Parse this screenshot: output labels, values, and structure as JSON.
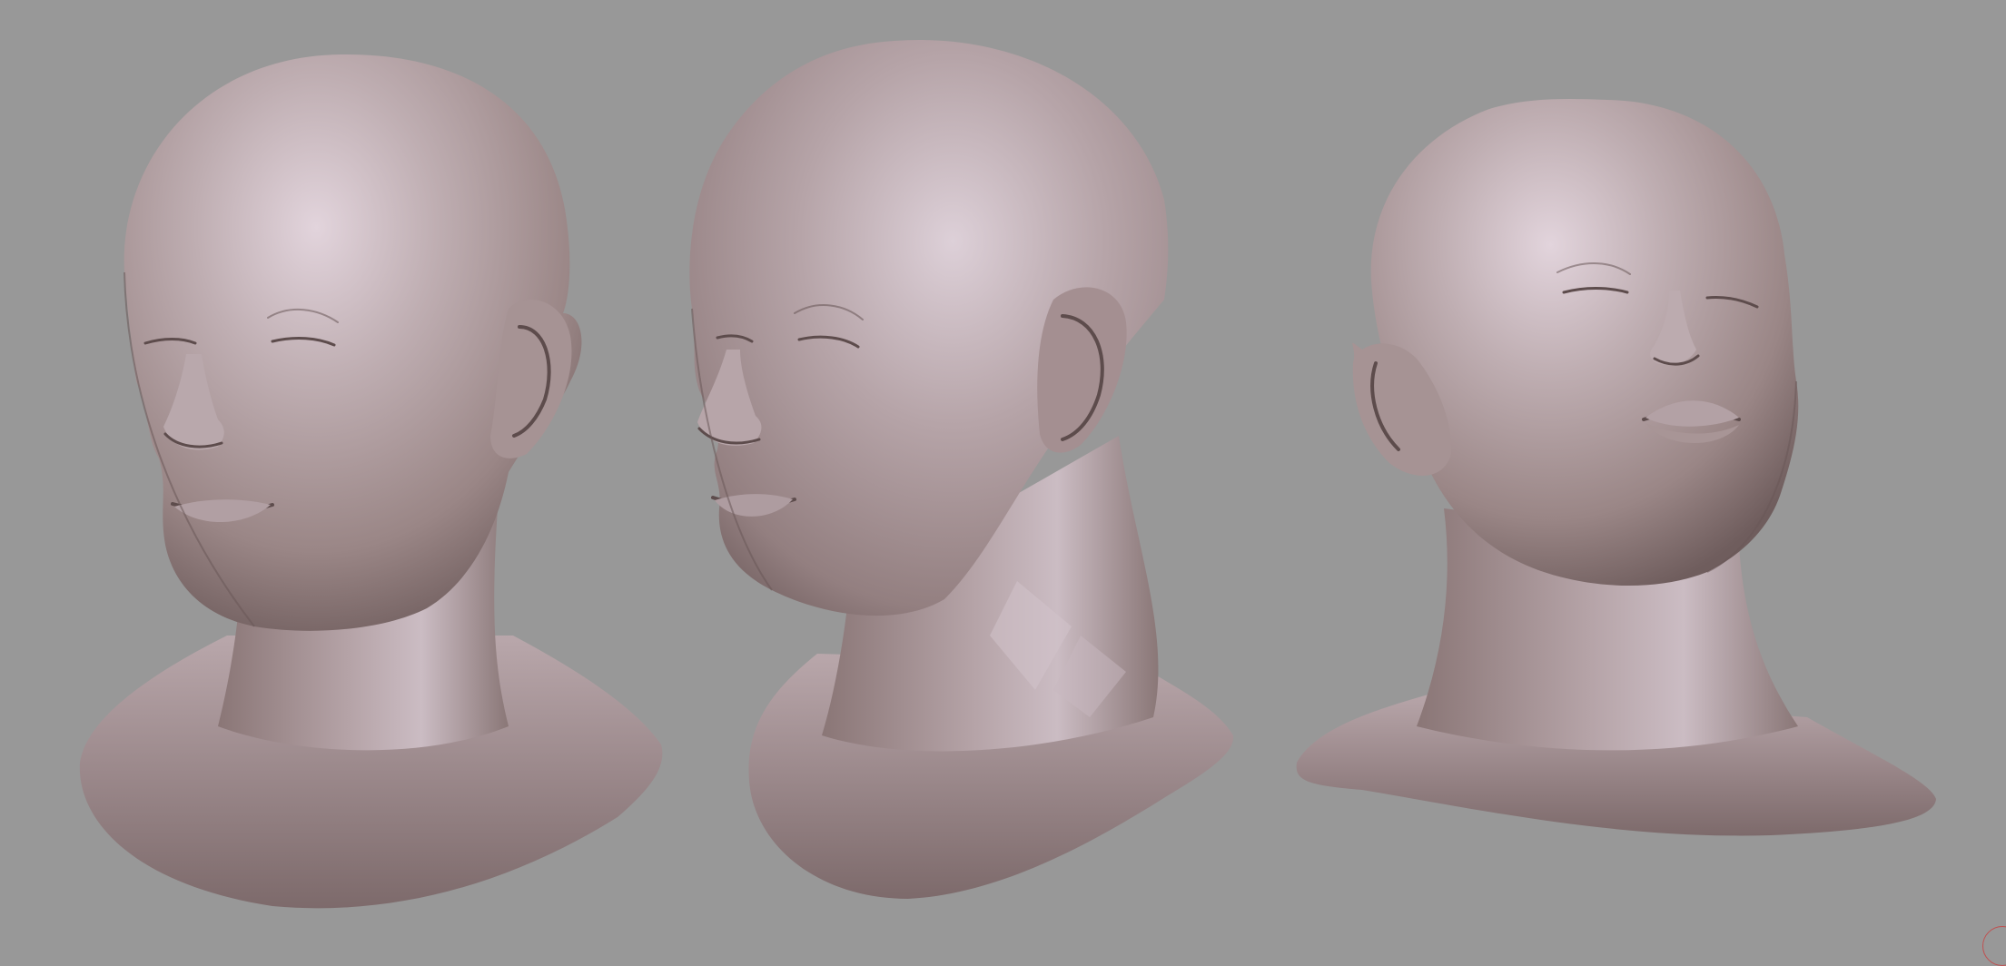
{
  "scene": {
    "background_color": "#989898",
    "material_base_color": "#a89696",
    "material_highlight_color": "#e2d4dc",
    "material_shadow_color": "#5d4c4c",
    "marker_color": "#c05050",
    "models": [
      {
        "id": "head-left",
        "view": "three-quarter-left"
      },
      {
        "id": "head-middle",
        "view": "three-quarter-left-turned"
      },
      {
        "id": "head-right",
        "view": "looking-up-right"
      }
    ]
  }
}
